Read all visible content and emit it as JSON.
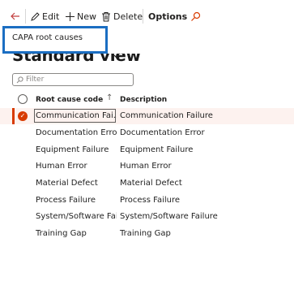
{
  "toolbar": {
    "edit_label": "Edit",
    "new_label": "New",
    "delete_label": "Delete",
    "options_label": "Options"
  },
  "context": {
    "label": "CAPA root causes"
  },
  "view": {
    "title": "Standard view"
  },
  "filter": {
    "placeholder": "Filter"
  },
  "grid": {
    "columns": {
      "code": "Root cause code",
      "description": "Description"
    },
    "rows": [
      {
        "code": "Communication Fai...",
        "description": "Communication Failure"
      },
      {
        "code": "Documentation Error",
        "description": "Documentation Error"
      },
      {
        "code": "Equipment Failure",
        "description": "Equipment Failure"
      },
      {
        "code": "Human Error",
        "description": "Human Error"
      },
      {
        "code": "Material Defect",
        "description": "Material Defect"
      },
      {
        "code": "Process Failure",
        "description": "Process Failure"
      },
      {
        "code": "System/Software Fail",
        "description": "System/Software Failure"
      },
      {
        "code": "Training Gap",
        "description": "Training Gap"
      }
    ]
  },
  "colors": {
    "accent": "#d83b01",
    "focus": "#1b6ec2"
  }
}
